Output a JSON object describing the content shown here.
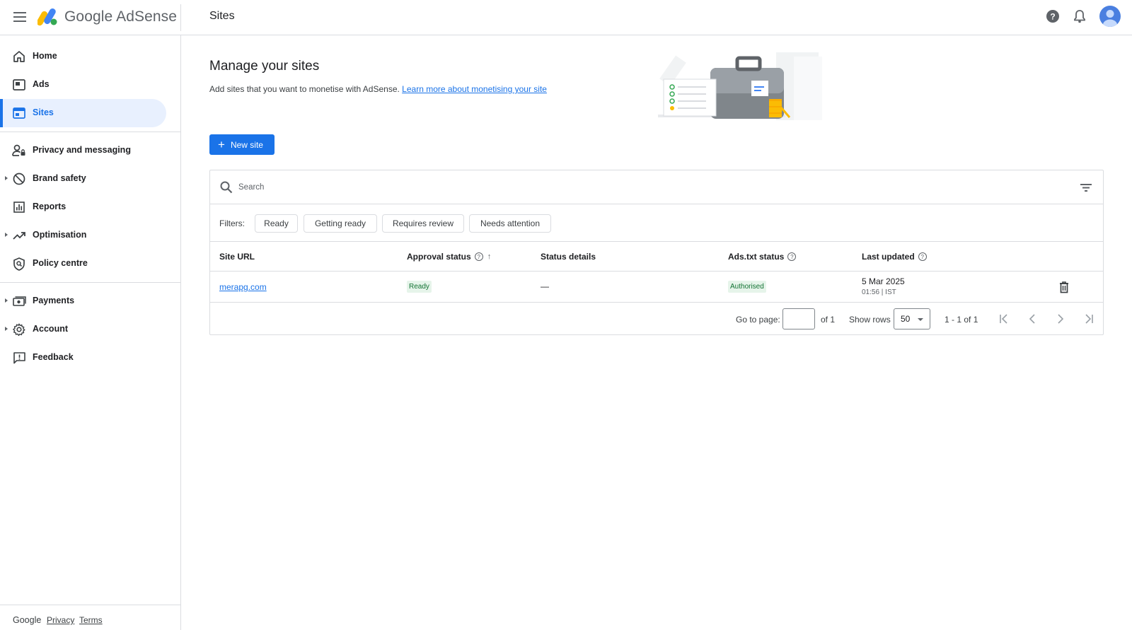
{
  "header": {
    "app_name_google": "Google",
    "app_name_product": "AdSense",
    "page_heading": "Sites",
    "icons": [
      "menu-icon",
      "help-icon",
      "notifications-icon",
      "avatar"
    ]
  },
  "sidebar": {
    "items": [
      {
        "label": "Home",
        "icon": "home-icon",
        "active": false,
        "expandable": false
      },
      {
        "label": "Ads",
        "icon": "ads-icon",
        "active": false,
        "expandable": false
      },
      {
        "label": "Sites",
        "icon": "sites-icon",
        "active": true,
        "expandable": false
      },
      {
        "label": "Privacy and messaging",
        "icon": "privacy-icon",
        "active": false,
        "expandable": false
      },
      {
        "label": "Brand safety",
        "icon": "block-icon",
        "active": false,
        "expandable": true
      },
      {
        "label": "Reports",
        "icon": "reports-icon",
        "active": false,
        "expandable": false
      },
      {
        "label": "Optimisation",
        "icon": "trending-icon",
        "active": false,
        "expandable": true
      },
      {
        "label": "Policy centre",
        "icon": "policy-icon",
        "active": false,
        "expandable": false
      },
      {
        "label": "Payments",
        "icon": "payments-icon",
        "active": false,
        "expandable": true
      },
      {
        "label": "Account",
        "icon": "gear-icon",
        "active": false,
        "expandable": true
      },
      {
        "label": "Feedback",
        "icon": "feedback-icon",
        "active": false,
        "expandable": false
      }
    ],
    "footer": {
      "brand": "Google",
      "privacy": "Privacy",
      "terms": "Terms"
    }
  },
  "main": {
    "title": "Manage your sites",
    "description": "Add sites that you want to monetise with AdSense.",
    "learn_more": "Learn more about monetising your site",
    "new_site_label": "New site",
    "search": {
      "placeholder": "Search"
    },
    "filters": {
      "label": "Filters:",
      "chips": [
        "Ready",
        "Getting ready",
        "Requires review",
        "Needs attention"
      ]
    },
    "table": {
      "columns": [
        "Site URL",
        "Approval status",
        "Status details",
        "Ads.txt status",
        "Last updated"
      ],
      "rows": [
        {
          "site_url": "merapg.com",
          "approval_status": "Ready",
          "status_details": "—",
          "ads_txt_status": "Authorised",
          "last_updated_date": "5 Mar 2025",
          "last_updated_time": "01:56 | IST"
        }
      ]
    },
    "pagination": {
      "go_to_page_label": "Go to page:",
      "page_value": "",
      "of_pages": "of 1",
      "show_rows_label": "Show rows",
      "rows_per_page": "50",
      "range": "1 - 1 of 1"
    }
  },
  "colors": {
    "accent": "#1a73e8",
    "active_nav_bg": "#e8f0fe",
    "badge_green_text": "#137333",
    "badge_green_bg": "#e6f4ea"
  }
}
